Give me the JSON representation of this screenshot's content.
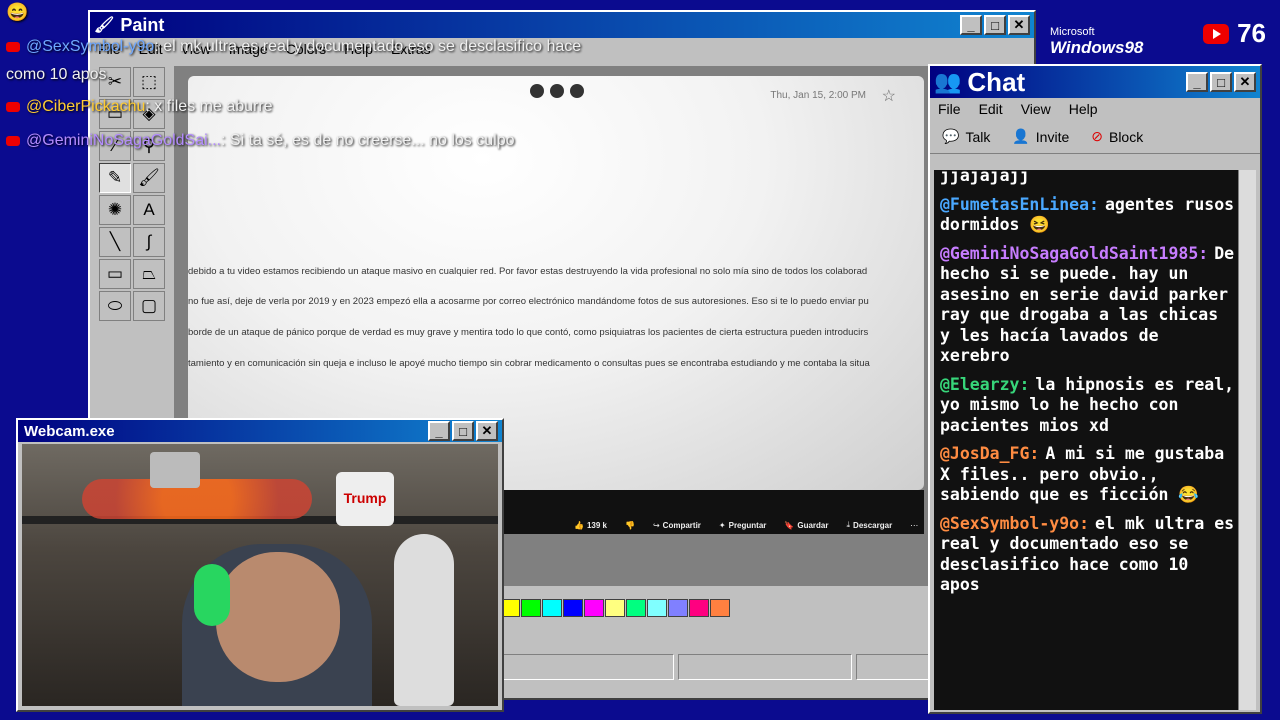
{
  "paint": {
    "title": "Paint",
    "menu": [
      "File",
      "Edit",
      "View",
      "Image",
      "Colors",
      "Help",
      "Extras"
    ],
    "doc": {
      "date": "Thu, Jan 15, 2:00 PM",
      "lines": [
        "debido a tu video estamos recibiendo un ataque masivo en cualquier red. Por favor estas destruyendo la vida profesional no solo mía sino de todos los colaborad",
        "no fue así, deje de verla por 2019 y en 2023 empezó ella a acosarme por correo electrónico mandándome fotos de sus autoresiones. Eso si te lo puedo enviar pu",
        "borde de un ataque de pánico porque de  verdad es muy grave y mentira todo lo que contó, como psiquiatras los pacientes de cierta estructura pueden introducirs",
        "tamiento y en comunicación sin queja e incluso le apoyé mucho tiempo sin cobrar medicamento o consultas pues se encontraba estudiando y me contaba la situa"
      ],
      "actions": [
        "139 k",
        "Compartir",
        "Preguntar",
        "Guardar",
        "Descargar"
      ]
    },
    "palette": [
      "#ffff00",
      "#00ff00",
      "#00ffff",
      "#0000ff",
      "#ff00ff",
      "#ffff80",
      "#00ff80",
      "#80ffff",
      "#8080ff",
      "#ff0080",
      "#ff8040"
    ]
  },
  "webcam": {
    "title": "Webcam.exe",
    "sign": "Trump"
  },
  "chat": {
    "title": "Chat",
    "menu": [
      "File",
      "Edit",
      "View",
      "Help"
    ],
    "toolbar": {
      "talk": "Talk",
      "invite": "Invite",
      "block": "Block"
    },
    "partial_top": "jjajajajj",
    "messages": [
      {
        "user": "@FumetasEnLinea:",
        "color": "#4aa8ff",
        "text": "agentes rusos dormidos 😆"
      },
      {
        "user": "@GeminiNoSagaGoldSaint1985:",
        "color": "#c77dff",
        "text": "De hecho si se puede. hay un asesino en serie david parker ray que drogaba a las chicas y les hacía lavados de xerebro"
      },
      {
        "user": "@Elearzy:",
        "color": "#37d67a",
        "text": "la hipnosis es real, yo mismo lo he hecho con pacientes mios xd"
      },
      {
        "user": "@JosDa_FG:",
        "color": "#ff8c42",
        "text": "A mi si me gustaba X files.. pero obvio., sabiendo que es ficción 😂"
      },
      {
        "user": "@SexSymbol-y9o:",
        "color": "#ff8c42",
        "text": "el mk ultra es real y documentado eso se desclasifico hace como 10 apos"
      }
    ]
  },
  "overlay": {
    "emoji": "😄",
    "lines": [
      {
        "user": "@SexSymbol-y9o",
        "text": ": el mk ultra es real y documentado eso se desclasifico hace"
      },
      {
        "user": "",
        "text": "como 10 apos"
      },
      {
        "user": "@CiberPickachu",
        "text": ": x files me aburre"
      },
      {
        "user": "@GeminiNoSagaGoldSai...",
        "text": ": Si ta sé, es de no creerse... no los culpo"
      }
    ],
    "viewer_count": "76",
    "win_logo_ms": "Microsoft",
    "win_logo": "Windows98"
  }
}
